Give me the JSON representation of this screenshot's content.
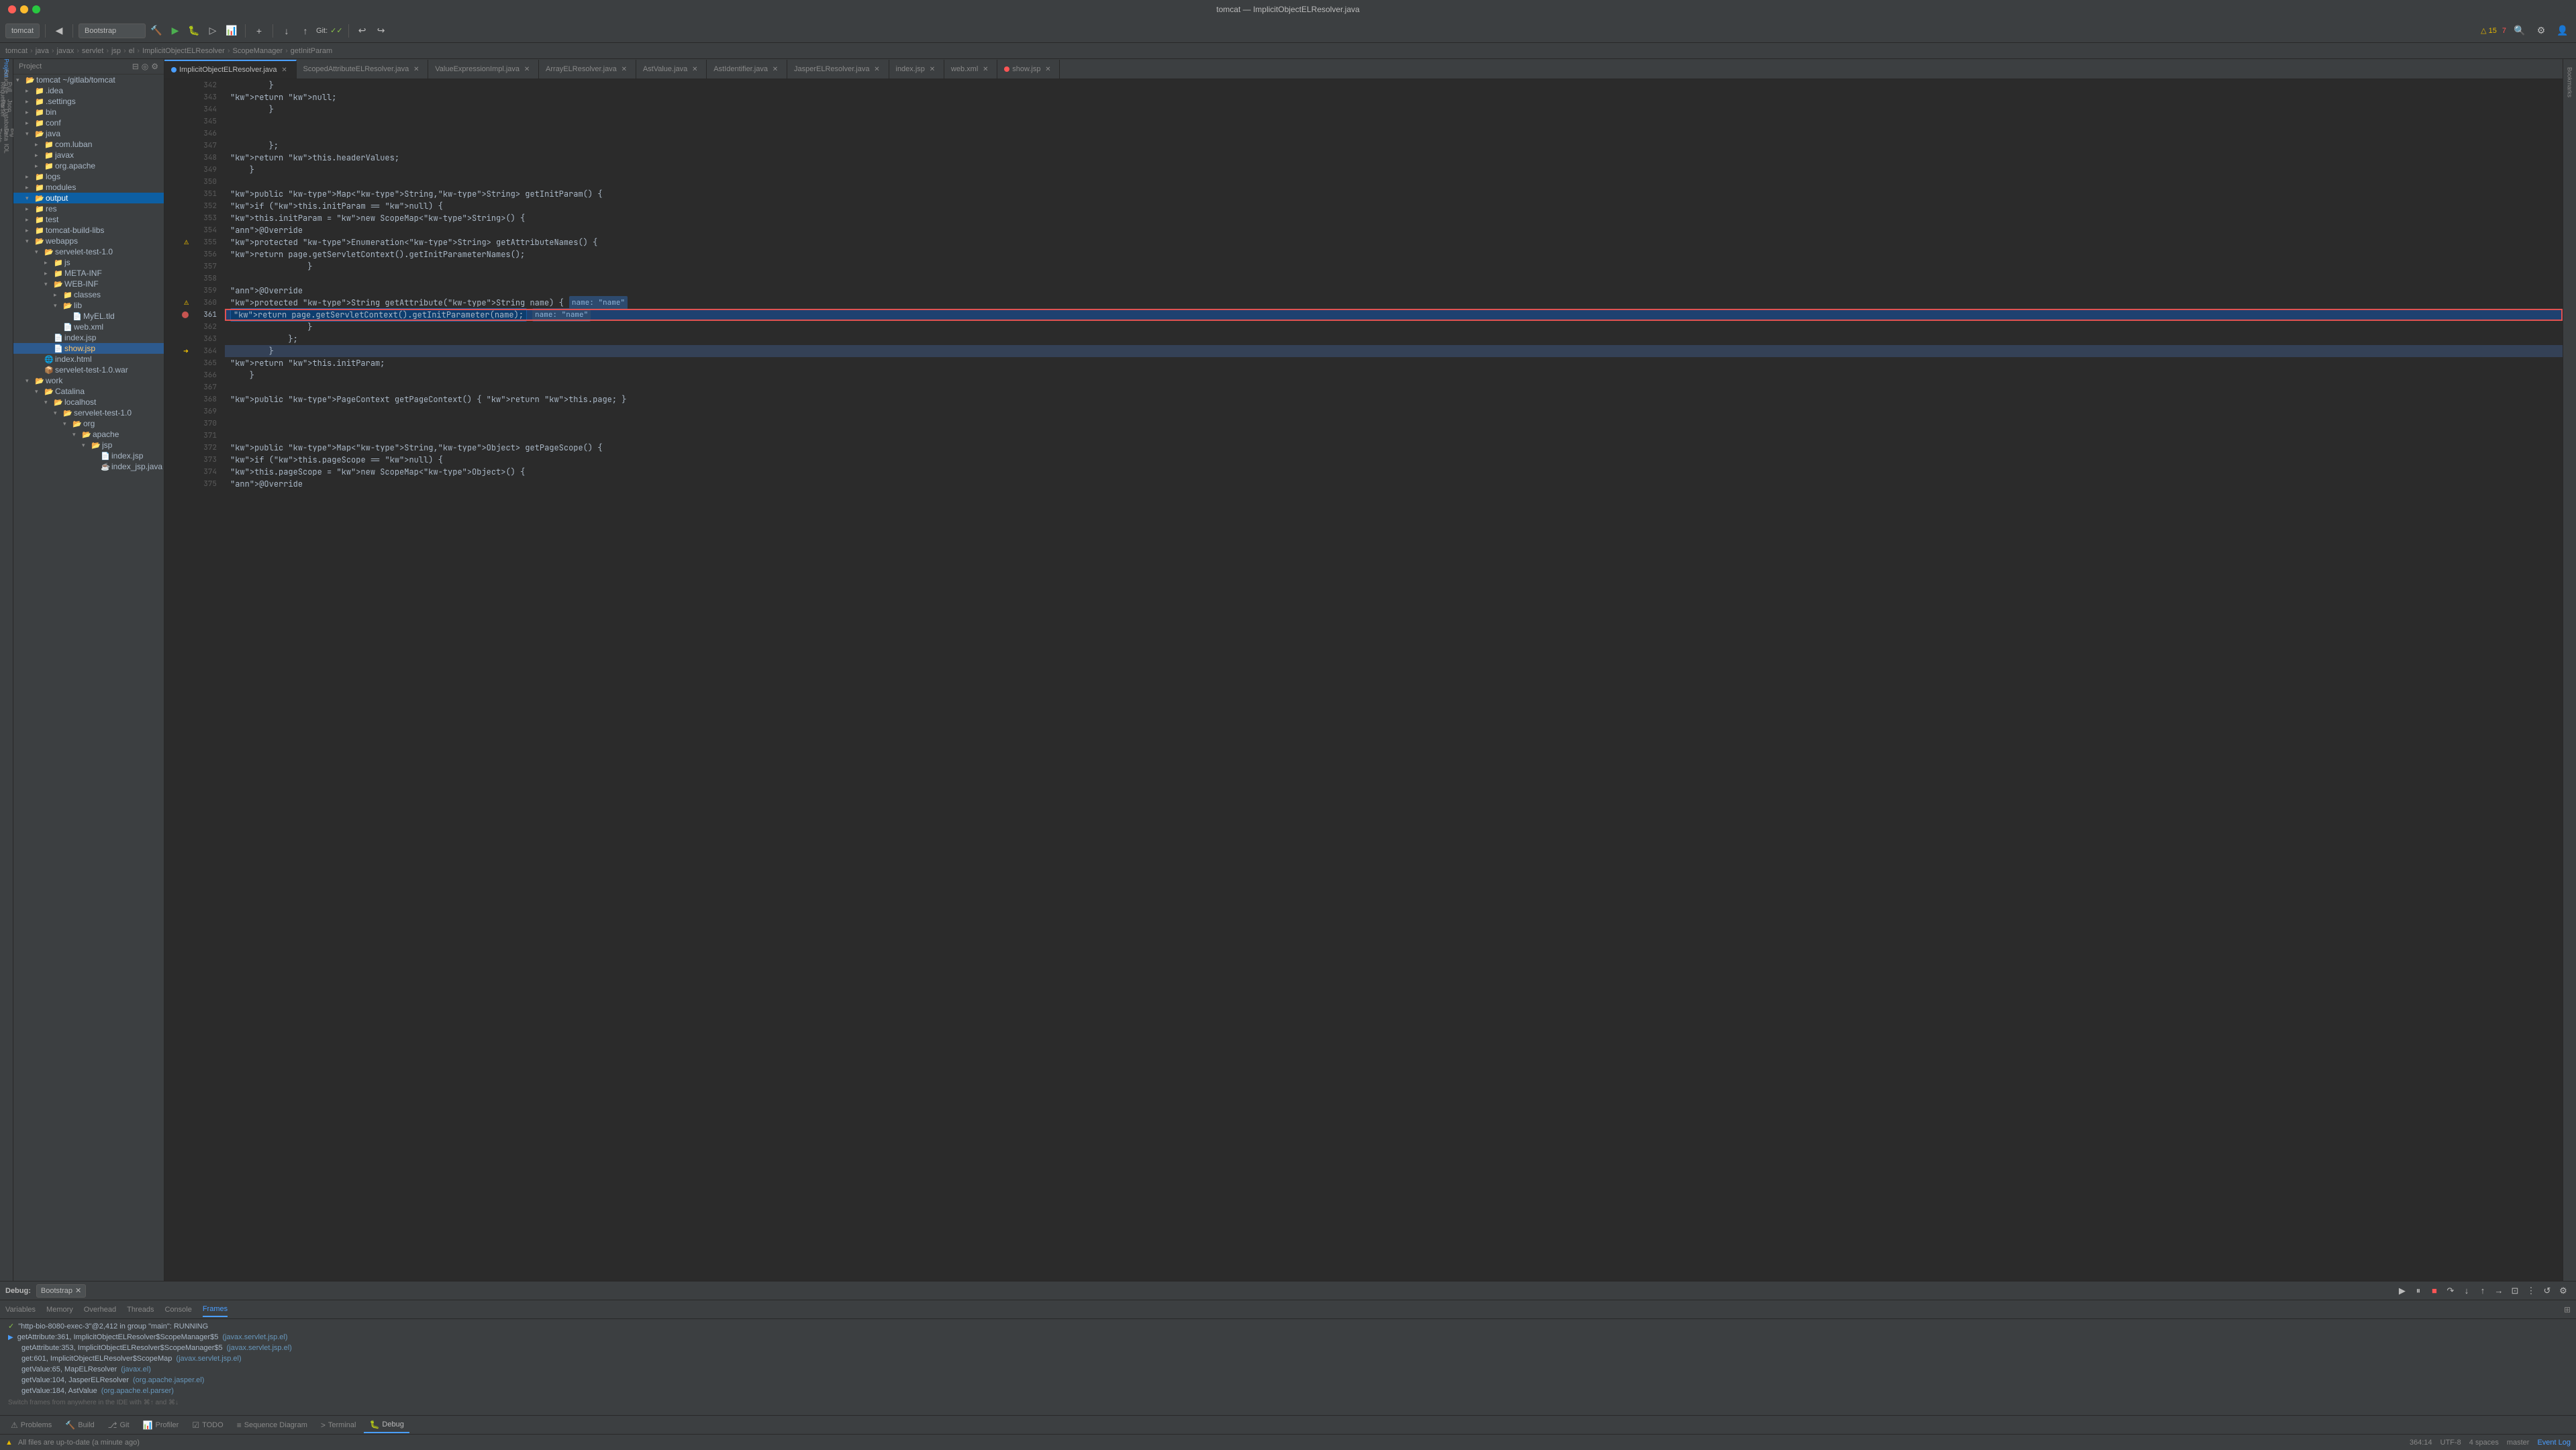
{
  "titleBar": {
    "title": "tomcat — ImplicitObjectELResolver.java"
  },
  "toolbar": {
    "projectLabel": "tomcat",
    "bootstrapLabel": "Bootstrap",
    "gitLabel": "Git:",
    "checkmarks": "✓✓",
    "warningCount": "△ 15",
    "errorCount": "7",
    "branchIcon": "⎇"
  },
  "breadcrumb": {
    "items": [
      "tomcat",
      "java",
      "javax",
      "servlet",
      "jsp",
      "el",
      "ImplicitObjectELResolver",
      "ScopeManager",
      "getInitParam"
    ]
  },
  "tabs": [
    {
      "label": "ImplicitObjectELResolver.java",
      "active": true,
      "dotColor": "blue"
    },
    {
      "label": "ScopedAttributeELResolver.java",
      "active": false
    },
    {
      "label": "ValueExpressionImpl.java",
      "active": false
    },
    {
      "label": "ArrayELResolver.java",
      "active": false
    },
    {
      "label": "AstValue.java",
      "active": false
    },
    {
      "label": "AstIdentifier.java",
      "active": false
    },
    {
      "label": "JasperELResolver.java",
      "active": false
    },
    {
      "label": "index.jsp",
      "active": false
    },
    {
      "label": "web.xml",
      "active": false
    },
    {
      "label": "show.jsp",
      "active": false,
      "dotColor": "red"
    }
  ],
  "fileTree": {
    "rootLabel": "Project",
    "items": [
      {
        "label": "tomcat ~/gitlab/tomcat",
        "indent": 0,
        "type": "folder",
        "expanded": true
      },
      {
        "label": ".idea",
        "indent": 1,
        "type": "folder",
        "expanded": false
      },
      {
        "label": ".settings",
        "indent": 1,
        "type": "folder",
        "expanded": false
      },
      {
        "label": "bin",
        "indent": 1,
        "type": "folder",
        "expanded": false
      },
      {
        "label": "conf",
        "indent": 1,
        "type": "folder",
        "expanded": false
      },
      {
        "label": "java",
        "indent": 1,
        "type": "folder",
        "expanded": true
      },
      {
        "label": "com.luban",
        "indent": 2,
        "type": "folder",
        "expanded": false
      },
      {
        "label": "javax",
        "indent": 2,
        "type": "folder",
        "expanded": false
      },
      {
        "label": "org.apache",
        "indent": 2,
        "type": "folder",
        "expanded": false
      },
      {
        "label": "logs",
        "indent": 1,
        "type": "folder",
        "expanded": false
      },
      {
        "label": "modules",
        "indent": 1,
        "type": "folder",
        "expanded": false
      },
      {
        "label": "output",
        "indent": 1,
        "type": "folder",
        "expanded": true,
        "selected": true
      },
      {
        "label": "res",
        "indent": 1,
        "type": "folder",
        "expanded": false
      },
      {
        "label": "test",
        "indent": 1,
        "type": "folder",
        "expanded": false
      },
      {
        "label": "tomcat-build-libs",
        "indent": 1,
        "type": "folder",
        "expanded": false
      },
      {
        "label": "webapps",
        "indent": 1,
        "type": "folder",
        "expanded": true
      },
      {
        "label": "servelet-test-1.0",
        "indent": 2,
        "type": "folder",
        "expanded": true
      },
      {
        "label": "js",
        "indent": 3,
        "type": "folder",
        "expanded": false
      },
      {
        "label": "META-INF",
        "indent": 3,
        "type": "folder",
        "expanded": false
      },
      {
        "label": "WEB-INF",
        "indent": 3,
        "type": "folder",
        "expanded": true
      },
      {
        "label": "classes",
        "indent": 4,
        "type": "folder",
        "expanded": false
      },
      {
        "label": "lib",
        "indent": 4,
        "type": "folder",
        "expanded": true
      },
      {
        "label": "MyEL.tld",
        "indent": 5,
        "type": "file-tld"
      },
      {
        "label": "web.xml",
        "indent": 4,
        "type": "file-xml"
      },
      {
        "label": "index.jsp",
        "indent": 3,
        "type": "file-jsp"
      },
      {
        "label": "show.jsp",
        "indent": 3,
        "type": "file-jsp",
        "highlighted": true
      },
      {
        "label": "index.html",
        "indent": 2,
        "type": "file-html"
      },
      {
        "label": "servelet-test-1.0.war",
        "indent": 2,
        "type": "file-jar"
      },
      {
        "label": "work",
        "indent": 1,
        "type": "folder",
        "expanded": true
      },
      {
        "label": "Catalina",
        "indent": 2,
        "type": "folder",
        "expanded": true
      },
      {
        "label": "localhost",
        "indent": 3,
        "type": "folder",
        "expanded": true
      },
      {
        "label": "servelet-test-1.0",
        "indent": 4,
        "type": "folder",
        "expanded": true
      },
      {
        "label": "org",
        "indent": 5,
        "type": "folder",
        "expanded": true
      },
      {
        "label": "apache",
        "indent": 6,
        "type": "folder",
        "expanded": true
      },
      {
        "label": "jsp",
        "indent": 7,
        "type": "folder",
        "expanded": true
      },
      {
        "label": "index.jsp",
        "indent": 8,
        "type": "file-jsp"
      },
      {
        "label": "index_jsp.java",
        "indent": 8,
        "type": "file-java"
      }
    ]
  },
  "codeLines": [
    {
      "num": 342,
      "content": "        }",
      "gutter": null
    },
    {
      "num": 343,
      "content": "            return null;",
      "gutter": null
    },
    {
      "num": 344,
      "content": "        }",
      "gutter": null
    },
    {
      "num": 345,
      "content": "",
      "gutter": null
    },
    {
      "num": 346,
      "content": "",
      "gutter": null
    },
    {
      "num": 347,
      "content": "        };",
      "gutter": null
    },
    {
      "num": 348,
      "content": "        return this.headerValues;",
      "gutter": null
    },
    {
      "num": 349,
      "content": "    }",
      "gutter": null
    },
    {
      "num": 350,
      "content": "",
      "gutter": null
    },
    {
      "num": 351,
      "content": "    public Map<String,String> getInitParam() {",
      "gutter": null
    },
    {
      "num": 352,
      "content": "        if (this.initParam == null) {",
      "gutter": null
    },
    {
      "num": 353,
      "content": "            this.initParam = new ScopeMap<String>() {",
      "gutter": null
    },
    {
      "num": 354,
      "content": "                @Override",
      "gutter": null
    },
    {
      "num": 355,
      "content": "                protected Enumeration<String> getAttributeNames() {",
      "gutter": "warning"
    },
    {
      "num": 356,
      "content": "                    return page.getServletContext().getInitParameterNames();",
      "gutter": null
    },
    {
      "num": 357,
      "content": "                }",
      "gutter": null
    },
    {
      "num": 358,
      "content": "",
      "gutter": null
    },
    {
      "num": 359,
      "content": "                @Override",
      "gutter": null
    },
    {
      "num": 360,
      "content": "                protected String getAttribute(String name) {",
      "gutter": "warning",
      "tooltip": "name: \"name\""
    },
    {
      "num": 361,
      "content": "                    return page.getServletContext().getInitParameter(name);",
      "gutter": "breakpoint",
      "debugLine": true,
      "tooltip": "name: \"name\""
    },
    {
      "num": 362,
      "content": "                }",
      "gutter": null
    },
    {
      "num": 363,
      "content": "            };",
      "gutter": null
    },
    {
      "num": 364,
      "content": "        }",
      "gutter": "arrow",
      "activeLine": true
    },
    {
      "num": 365,
      "content": "        return this.initParam;",
      "gutter": null
    },
    {
      "num": 366,
      "content": "    }",
      "gutter": null
    },
    {
      "num": 367,
      "content": "",
      "gutter": null
    },
    {
      "num": 368,
      "content": "    public PageContext getPageContext() { return this.page; }",
      "gutter": null
    },
    {
      "num": 369,
      "content": "",
      "gutter": null
    },
    {
      "num": 370,
      "content": "",
      "gutter": null
    },
    {
      "num": 371,
      "content": "",
      "gutter": null
    },
    {
      "num": 372,
      "content": "    public Map<String,Object> getPageScope() {",
      "gutter": null
    },
    {
      "num": 373,
      "content": "        if (this.pageScope == null) {",
      "gutter": null
    },
    {
      "num": 374,
      "content": "            this.pageScope = new ScopeMap<Object>() {",
      "gutter": null
    },
    {
      "num": 375,
      "content": "                @Override",
      "gutter": null
    }
  ],
  "debugPanel": {
    "label": "Debug:",
    "config": "Bootstrap",
    "tabs": [
      "Variables",
      "Memory",
      "Overhead",
      "Threads",
      "Console",
      "Frames"
    ],
    "activeTab": "Frames",
    "frames": [
      {
        "arrow": true,
        "running": false,
        "method": "getAttribute:361, ImplicitObjectELResolver$ScopeManager$5",
        "location": "(javax.servlet.jsp.el)",
        "current": true
      },
      {
        "arrow": false,
        "running": false,
        "method": "getAttribute:353, ImplicitObjectELResolver$ScopeManager$5",
        "location": "(javax.servlet.jsp.el)",
        "current": false
      },
      {
        "arrow": false,
        "running": false,
        "method": "get:601, ImplicitObjectELResolver$ScopeMap",
        "location": "(javax.servlet.jsp.el)",
        "current": false
      },
      {
        "arrow": false,
        "running": false,
        "method": "getValue:65, MapELResolver",
        "location": "(javax.el)",
        "current": false
      },
      {
        "arrow": false,
        "running": false,
        "method": "getValue:104, JasperELResolver",
        "location": "(org.apache.jasper.el)",
        "current": false
      },
      {
        "arrow": false,
        "running": false,
        "method": "getValue:184, AstValue",
        "location": "(org.apache.el.parser)",
        "current": false
      }
    ],
    "hint": "Switch frames from anywhere in the IDE with ⌘↑ and ⌘↓"
  },
  "bottomTabs": [
    {
      "label": "Problems",
      "icon": "⚠"
    },
    {
      "label": "Build",
      "icon": "🔨"
    },
    {
      "label": "Git",
      "icon": "⎇"
    },
    {
      "label": "Profiler",
      "icon": "📊",
      "active": false
    },
    {
      "label": "TODO",
      "icon": "☑"
    },
    {
      "label": "Sequence Diagram",
      "icon": "≡"
    },
    {
      "label": "Terminal",
      "icon": ">"
    },
    {
      "label": "Debug",
      "icon": "🐛",
      "active": true
    }
  ],
  "statusBar": {
    "lineInfo": "364:14",
    "encoding": "UTF-8",
    "indent": "4 spaces",
    "branch": "master",
    "eventLog": "Event Log",
    "warningText": "△ 15",
    "errorText": "7",
    "fileStatus": "All files are up-to-date (a minute ago)"
  }
}
